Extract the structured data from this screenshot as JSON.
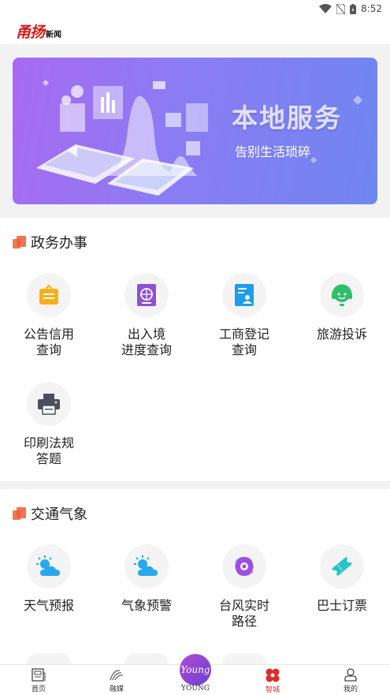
{
  "status_bar": {
    "time": "8:52"
  },
  "header": {
    "logo_main": "甬扬",
    "logo_sub": "新闻"
  },
  "banner": {
    "title": "本地服务",
    "subtitle": "告别生活琐碎"
  },
  "sections": [
    {
      "title": "政务办事",
      "items": [
        {
          "label": "公告信用\n查询",
          "icon": "notice-credit-icon",
          "color": "#f5b01a"
        },
        {
          "label": "出入境\n进度查询",
          "icon": "passport-icon",
          "color": "#8f4fd8"
        },
        {
          "label": "工商登记\n查询",
          "icon": "business-registration-icon",
          "color": "#1e9de8"
        },
        {
          "label": "旅游投诉",
          "icon": "customer-service-icon",
          "color": "#2fbf6a"
        },
        {
          "label": "印刷法规\n答题",
          "icon": "printer-icon",
          "color": "#4a4f5a"
        }
      ]
    },
    {
      "title": "交通气象",
      "items": [
        {
          "label": "天气预报",
          "icon": "weather-sun-cloud-icon",
          "color": "#29a8ee"
        },
        {
          "label": "气象预警",
          "icon": "weather-warning-icon",
          "color": "#29a8ee"
        },
        {
          "label": "台风实时\n路径",
          "icon": "typhoon-icon",
          "color": "#9c4fe0"
        },
        {
          "label": "巴士订票",
          "icon": "bus-ticket-icon",
          "color": "#22c4c8"
        }
      ]
    }
  ],
  "bottom_nav": [
    {
      "label": "首页",
      "icon": "home-news-icon"
    },
    {
      "label": "融媒",
      "icon": "media-icon"
    },
    {
      "label": "YOUNG",
      "icon": "young-logo-icon",
      "badge": "Young"
    },
    {
      "label": "智城",
      "icon": "smart-city-icon",
      "active": true
    },
    {
      "label": "我的",
      "icon": "profile-icon"
    }
  ],
  "colors": {
    "accent": "#e02b2b",
    "banner_start": "#a86af2",
    "banner_end": "#6f86f0"
  }
}
